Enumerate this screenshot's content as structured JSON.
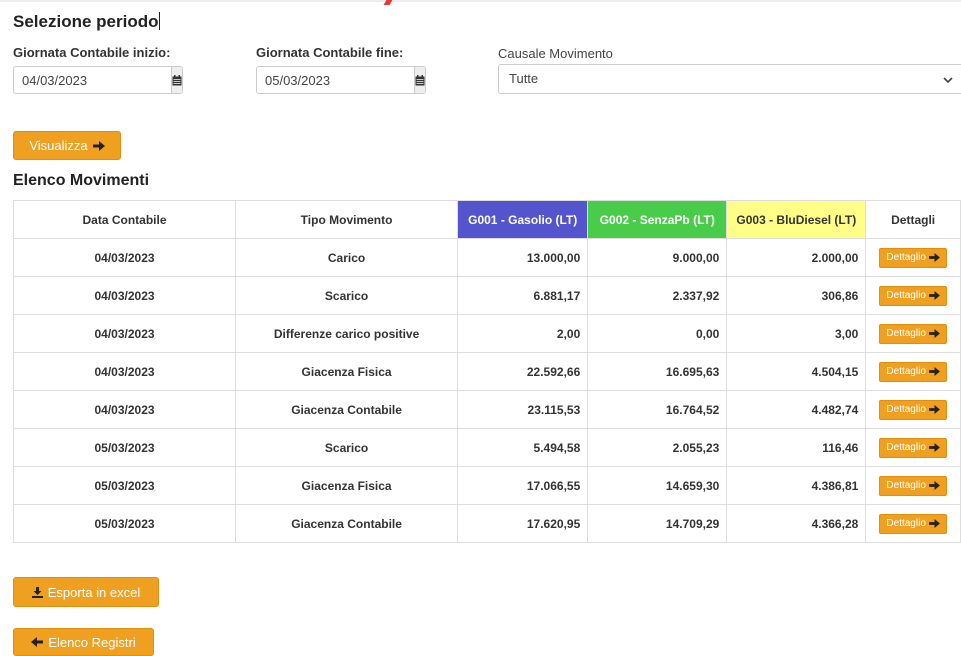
{
  "header": {
    "title": "Selezione periodo"
  },
  "filters": {
    "start_label": "Giornata Contabile inizio:",
    "start_value": "04/03/2023",
    "end_label": "Giornata Contabile fine:",
    "end_value": "05/03/2023",
    "causale_label": "Causale Movimento",
    "causale_value": "Tutte"
  },
  "actions": {
    "visualizza_label": "Visualizza"
  },
  "list": {
    "title": "Elenco Movimenti",
    "columns": [
      "Data Contabile",
      "Tipo Movimento",
      "G001 - Gasolio (LT)",
      "G002 - SenzaPb (LT)",
      "G003 - BluDiesel (LT)",
      "Dettagli"
    ],
    "column_colors": {
      "g001": "#5454cc",
      "g002": "#49cc49",
      "g003": "#ffff88"
    },
    "detail_label": "Dettaglio",
    "rows": [
      {
        "data": "04/03/2023",
        "tipo": "Carico",
        "g001": "13.000,00",
        "g002": "9.000,00",
        "g003": "2.000,00"
      },
      {
        "data": "04/03/2023",
        "tipo": "Scarico",
        "g001": "6.881,17",
        "g002": "2.337,92",
        "g003": "306,86"
      },
      {
        "data": "04/03/2023",
        "tipo": "Differenze carico positive",
        "g001": "2,00",
        "g002": "0,00",
        "g003": "3,00"
      },
      {
        "data": "04/03/2023",
        "tipo": "Giacenza Fisica",
        "g001": "22.592,66",
        "g002": "16.695,63",
        "g003": "4.504,15"
      },
      {
        "data": "04/03/2023",
        "tipo": "Giacenza Contabile",
        "g001": "23.115,53",
        "g002": "16.764,52",
        "g003": "4.482,74"
      },
      {
        "data": "05/03/2023",
        "tipo": "Scarico",
        "g001": "5.494,58",
        "g002": "2.055,23",
        "g003": "116,46"
      },
      {
        "data": "05/03/2023",
        "tipo": "Giacenza Fisica",
        "g001": "17.066,55",
        "g002": "14.659,30",
        "g003": "4.386,81"
      },
      {
        "data": "05/03/2023",
        "tipo": "Giacenza Contabile",
        "g001": "17.620,95",
        "g002": "14.709,29",
        "g003": "4.366,28"
      }
    ]
  },
  "footer": {
    "export_label": "Esporta in excel",
    "back_label": "Elenco Registri"
  },
  "icons": {
    "calendar": "calendar-icon",
    "arrow_right": "arrow-right-icon",
    "download": "download-icon",
    "arrow_left": "arrow-left-icon",
    "chevron": "chevron-down-icon"
  }
}
